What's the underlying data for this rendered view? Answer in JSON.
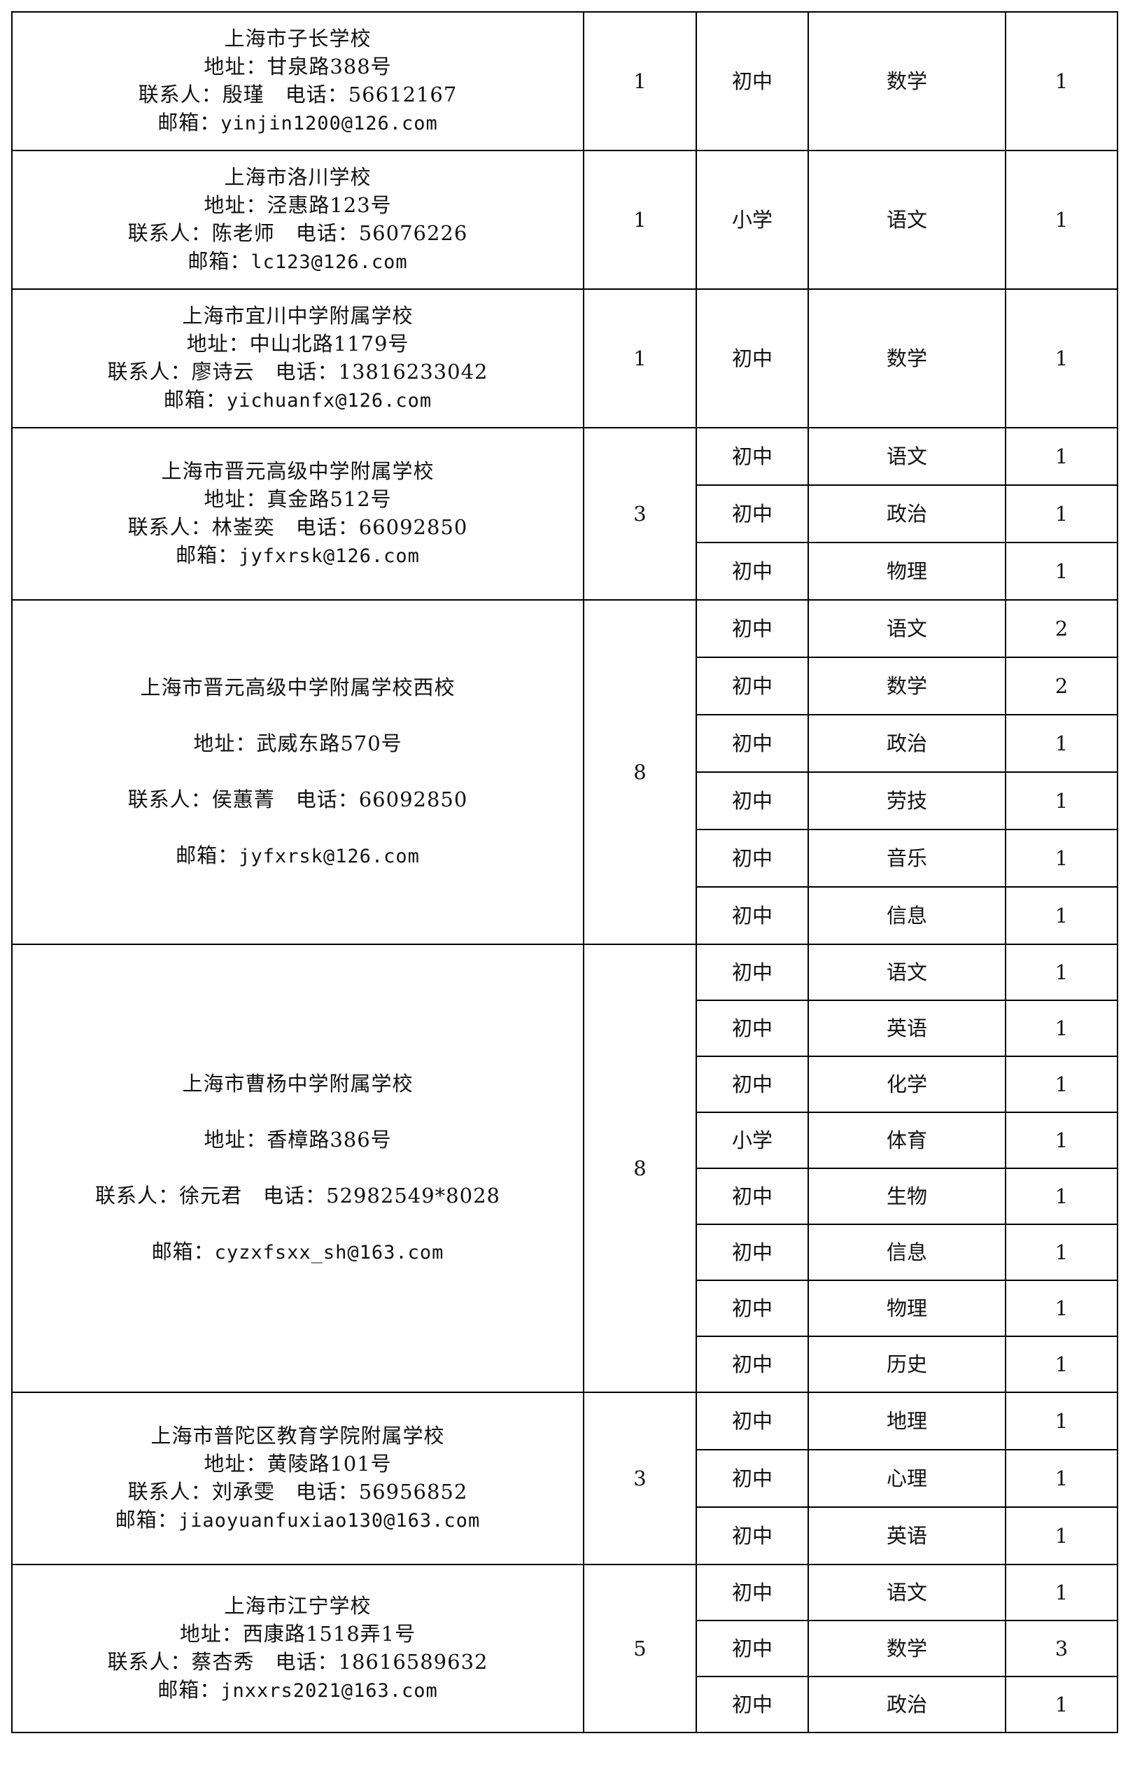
{
  "table": {
    "groups": [
      {
        "school": "上海市子长学校",
        "address_label": "地址：",
        "address": "甘泉路388号",
        "contact_label": "联系人：",
        "contact": "殷瑾",
        "phone_label": "电话：",
        "phone": "56612167",
        "email_label": "邮箱：",
        "email": "yinjin1200@126.com",
        "total": "1",
        "positions": [
          {
            "level": "初中",
            "subject": "数学",
            "count": "1"
          }
        ]
      },
      {
        "school": "上海市洛川学校",
        "address_label": "地址：",
        "address": "泾惠路123号",
        "contact_label": "联系人：",
        "contact": "陈老师",
        "phone_label": "电话：",
        "phone": "56076226",
        "email_label": "邮箱：",
        "email": "lc123@126.com",
        "total": "1",
        "positions": [
          {
            "level": "小学",
            "subject": "语文",
            "count": "1"
          }
        ]
      },
      {
        "school": "上海市宜川中学附属学校",
        "address_label": "地址：",
        "address": "中山北路1179号",
        "contact_label": "联系人：",
        "contact": "廖诗云",
        "phone_label": "电话：",
        "phone": "13816233042",
        "email_label": "邮箱：",
        "email": "yichuanfx@126.com",
        "total": "1",
        "positions": [
          {
            "level": "初中",
            "subject": "数学",
            "count": "1"
          }
        ]
      },
      {
        "school": "上海市晋元高级中学附属学校",
        "address_label": "地址：",
        "address": "真金路512号",
        "contact_label": "联系人：",
        "contact": "林崟奕",
        "phone_label": "电话：",
        "phone": "66092850",
        "email_label": "邮箱：",
        "email": "jyfxrsk@126.com",
        "total": "3",
        "positions": [
          {
            "level": "初中",
            "subject": "语文",
            "count": "1"
          },
          {
            "level": "初中",
            "subject": "政治",
            "count": "1"
          },
          {
            "level": "初中",
            "subject": "物理",
            "count": "1"
          }
        ]
      },
      {
        "school": "上海市晋元高级中学附属学校西校",
        "address_label": "地址：",
        "address": "武威东路570号",
        "contact_label": "联系人：",
        "contact": "侯蕙菁",
        "phone_label": "电话：",
        "phone": "66092850",
        "email_label": "邮箱：",
        "email": "jyfxrsk@126.com",
        "total": "8",
        "positions": [
          {
            "level": "初中",
            "subject": "语文",
            "count": "2"
          },
          {
            "level": "初中",
            "subject": "数学",
            "count": "2"
          },
          {
            "level": "初中",
            "subject": "政治",
            "count": "1"
          },
          {
            "level": "初中",
            "subject": "劳技",
            "count": "1"
          },
          {
            "level": "初中",
            "subject": "音乐",
            "count": "1"
          },
          {
            "level": "初中",
            "subject": "信息",
            "count": "1"
          }
        ]
      },
      {
        "school": "上海市曹杨中学附属学校",
        "address_label": "地址：",
        "address": "香樟路386号",
        "contact_label": "联系人：",
        "contact": "徐元君",
        "phone_label": "电话：",
        "phone": "52982549*8028",
        "email_label": "邮箱：",
        "email": "cyzxfsxx_sh@163.com",
        "total": "8",
        "positions": [
          {
            "level": "初中",
            "subject": "语文",
            "count": "1"
          },
          {
            "level": "初中",
            "subject": "英语",
            "count": "1"
          },
          {
            "level": "初中",
            "subject": "化学",
            "count": "1"
          },
          {
            "level": "小学",
            "subject": "体育",
            "count": "1"
          },
          {
            "level": "初中",
            "subject": "生物",
            "count": "1"
          },
          {
            "level": "初中",
            "subject": "信息",
            "count": "1"
          },
          {
            "level": "初中",
            "subject": "物理",
            "count": "1"
          },
          {
            "level": "初中",
            "subject": "历史",
            "count": "1"
          }
        ]
      },
      {
        "school": "上海市普陀区教育学院附属学校",
        "address_label": "地址：",
        "address": "黄陵路101号",
        "contact_label": "联系人：",
        "contact": "刘承雯",
        "phone_label": "电话：",
        "phone": "56956852",
        "email_label": "邮箱：",
        "email": "jiaoyuanfuxiao130@163.com",
        "total": "3",
        "positions": [
          {
            "level": "初中",
            "subject": "地理",
            "count": "1"
          },
          {
            "level": "初中",
            "subject": "心理",
            "count": "1"
          },
          {
            "level": "初中",
            "subject": "英语",
            "count": "1"
          }
        ]
      },
      {
        "school": "上海市江宁学校",
        "address_label": "地址：",
        "address": "西康路1518弄1号",
        "contact_label": "联系人：",
        "contact": "蔡杏秀",
        "phone_label": "电话：",
        "phone": "18616589632",
        "email_label": "邮箱：",
        "email": "jnxxrs2021@163.com",
        "total": "5",
        "positions": [
          {
            "level": "初中",
            "subject": "语文",
            "count": "1"
          },
          {
            "level": "初中",
            "subject": "数学",
            "count": "3"
          },
          {
            "level": "初中",
            "subject": "政治",
            "count": "1"
          }
        ]
      }
    ]
  }
}
